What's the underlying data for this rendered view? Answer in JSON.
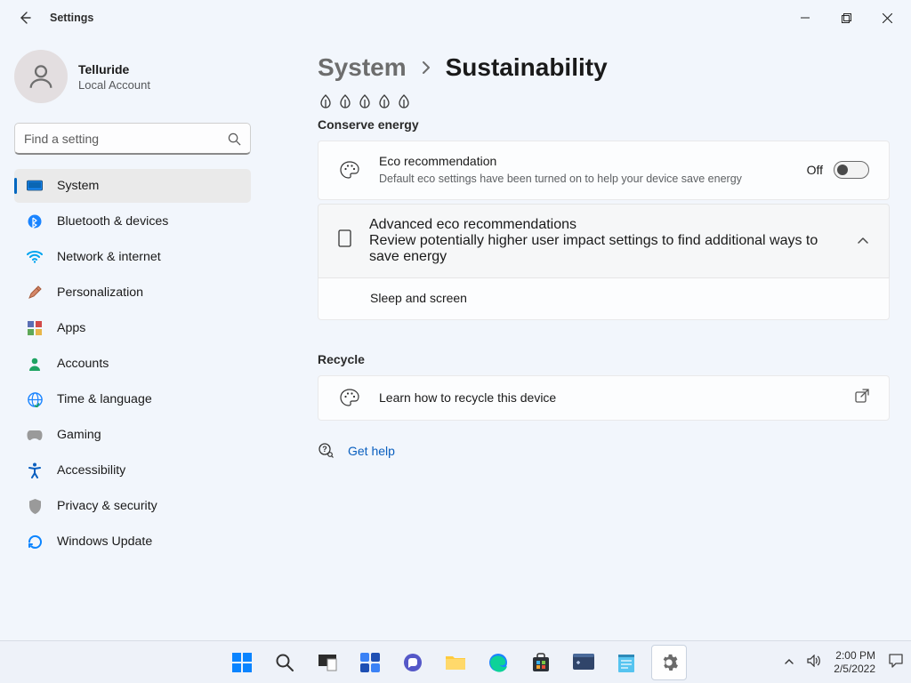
{
  "app": {
    "title": "Settings"
  },
  "user": {
    "name": "Telluride",
    "subtitle": "Local Account"
  },
  "search": {
    "placeholder": "Find a setting"
  },
  "nav": {
    "items": [
      {
        "label": "System",
        "icon": "desktop",
        "active": true
      },
      {
        "label": "Bluetooth & devices",
        "icon": "bluetooth"
      },
      {
        "label": "Network & internet",
        "icon": "wifi"
      },
      {
        "label": "Personalization",
        "icon": "brush"
      },
      {
        "label": "Apps",
        "icon": "apps"
      },
      {
        "label": "Accounts",
        "icon": "person"
      },
      {
        "label": "Time & language",
        "icon": "globe"
      },
      {
        "label": "Gaming",
        "icon": "gamepad"
      },
      {
        "label": "Accessibility",
        "icon": "accessibility"
      },
      {
        "label": "Privacy & security",
        "icon": "shield"
      },
      {
        "label": "Windows Update",
        "icon": "update"
      }
    ]
  },
  "breadcrumb": {
    "parent": "System",
    "current": "Sustainability"
  },
  "sections": {
    "conserve": {
      "title": "Conserve energy",
      "eco": {
        "title": "Eco recommendation",
        "subtitle": "Default eco settings have been turned on to help your device save energy",
        "toggle_label": "Off"
      },
      "advanced": {
        "title": "Advanced eco recommendations",
        "subtitle": "Review potentially higher user impact settings to find additional ways to save energy",
        "child": "Sleep and screen"
      }
    },
    "recycle": {
      "title": "Recycle",
      "learn": "Learn how to recycle this device"
    }
  },
  "help": {
    "label": "Get help"
  },
  "taskbar": {
    "time": "2:00 PM",
    "date": "2/5/2022"
  }
}
